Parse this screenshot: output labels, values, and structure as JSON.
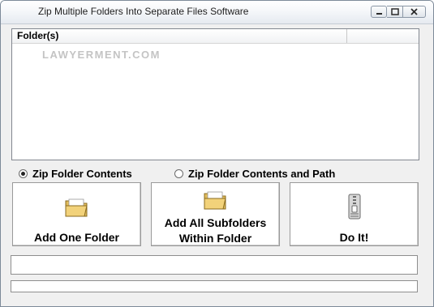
{
  "window": {
    "title": "Zip Multiple Folders Into Separate Files Software"
  },
  "folder_list": {
    "column_header": "Folder(s)",
    "watermark": "LAWYERMENT.COM",
    "rows": []
  },
  "options": {
    "zip_folder_contents": {
      "label": "Zip Folder Contents",
      "selected": true
    },
    "zip_folder_contents_and_path": {
      "label": "Zip Folder Contents and Path",
      "selected": false
    }
  },
  "buttons": {
    "add_one_folder": {
      "label": "Add One Folder",
      "icon": "folder-open-icon"
    },
    "add_all_subfolders": {
      "label_line1": "Add All Subfolders",
      "label_line2": "Within Folder",
      "icon": "folder-open-icon"
    },
    "do_it": {
      "label": "Do It!",
      "icon": "zip-file-icon"
    }
  },
  "status": {
    "message": "",
    "progress": 0
  },
  "colors": {
    "folder": "#f2d27a",
    "zip_accent": "#6a6a6a"
  }
}
